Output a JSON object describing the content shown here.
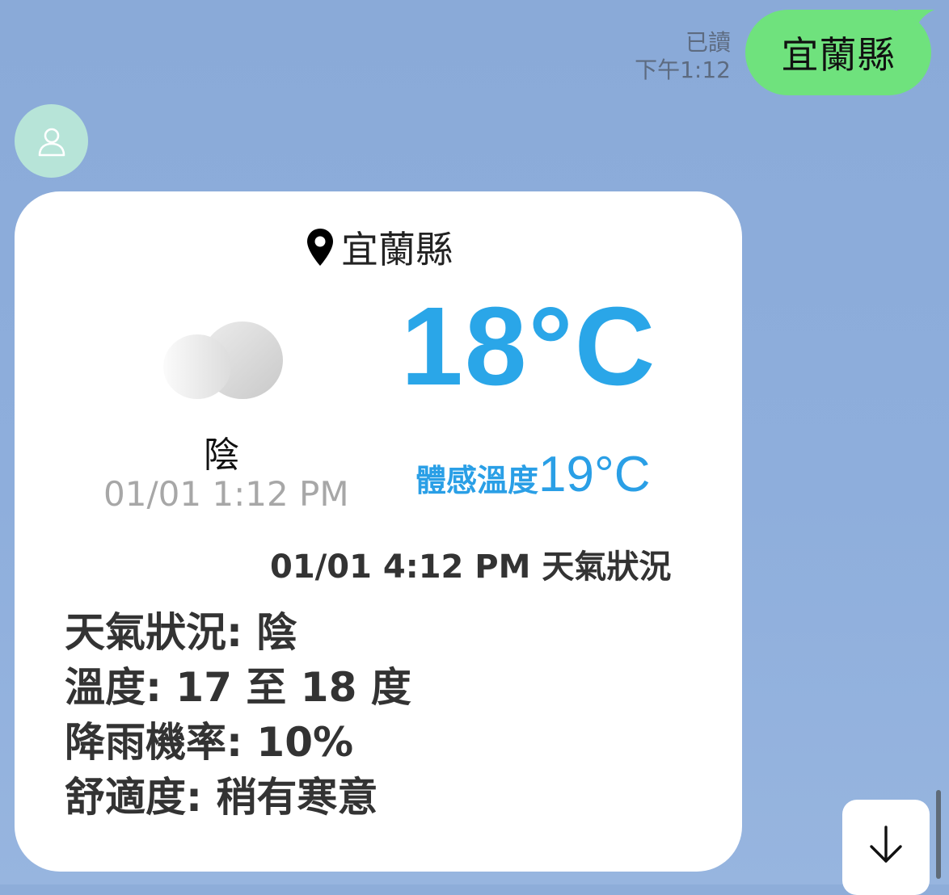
{
  "chat": {
    "outgoing": {
      "read_label": "已讀",
      "time": "下午1:12",
      "message": "宜蘭縣",
      "bubble_color": "#6fe27d"
    }
  },
  "card": {
    "location": "宜蘭縣",
    "current": {
      "condition": "陰",
      "observed_time": "01/01 1:12 PM",
      "temperature": "18°C",
      "feels_like_label": "體感溫度",
      "feels_like_value": "19°C",
      "temperature_color": "#2aa6e8"
    },
    "forecast_title": "01/01 4:12 PM 天氣狀況",
    "forecast_lines": [
      "天氣狀況: 陰",
      "溫度: 17 至 18 度",
      "降雨機率: 10%",
      "舒適度: 稍有寒意"
    ]
  },
  "icons": {
    "avatar": "user-icon",
    "location": "map-pin-icon",
    "weather": "cloud-icon",
    "scroll": "arrow-down-icon"
  }
}
